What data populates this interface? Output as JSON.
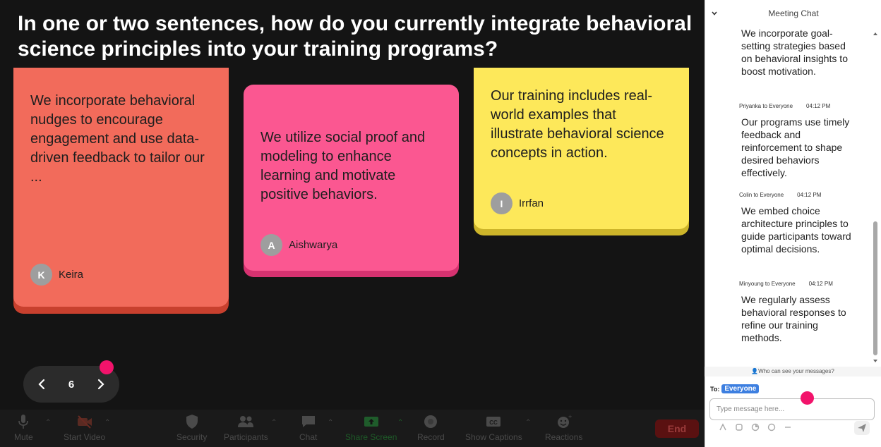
{
  "question": "In one or two sentences, how do you currently integrate behavioral science principles into your training programs?",
  "notes": [
    {
      "text": "We incorporate behavioral nudges to encourage engagement and use data-driven feedback to tailor our ...",
      "initial": "K",
      "author": "Keira",
      "color": "#f26b5b"
    },
    {
      "text": "We utilize social proof and modeling to enhance learning and motivate positive behaviors.",
      "initial": "A",
      "author": "Aishwarya",
      "color": "#fb5791"
    },
    {
      "text": "Our training includes real-world examples that illustrate behavioral science concepts in action.",
      "initial": "I",
      "author": "Irrfan",
      "color": "#fde85a"
    }
  ],
  "pager": {
    "page": "6"
  },
  "toolbar": {
    "mute": "Mute",
    "start_video": "Start Video",
    "security": "Security",
    "participants": "Participants",
    "chat": "Chat",
    "share_screen": "Share Screen",
    "record": "Record",
    "show_captions": "Show Captions",
    "reactions": "Reactions",
    "end": "End"
  },
  "chat": {
    "title": "Meeting Chat",
    "messages": [
      {
        "sender": "",
        "time": "",
        "text": "We incorporate goal-setting strategies based on behavioral insights to boost motivation."
      },
      {
        "sender": "Priyanka to Everyone",
        "time": "04:12 PM",
        "text": "Our programs use timely feedback and reinforcement to shape desired behaviors effectively."
      },
      {
        "sender": "Colin to Everyone",
        "time": "04:12 PM",
        "text": "We embed choice architecture principles to guide participants toward optimal decisions."
      },
      {
        "sender": "Minyoung to Everyone",
        "time": "04:12 PM",
        "text": "We regularly assess behavioral responses to refine our training methods."
      }
    ],
    "privacy_note": "Who can see your messages?",
    "to_label": "To:",
    "recipient": "Everyone",
    "input_placeholder": "Type message here..."
  },
  "colors": {
    "accent_dot": "#f2136b",
    "recipient_pill": "#3d7fe0",
    "end_button": "#5a1111"
  }
}
